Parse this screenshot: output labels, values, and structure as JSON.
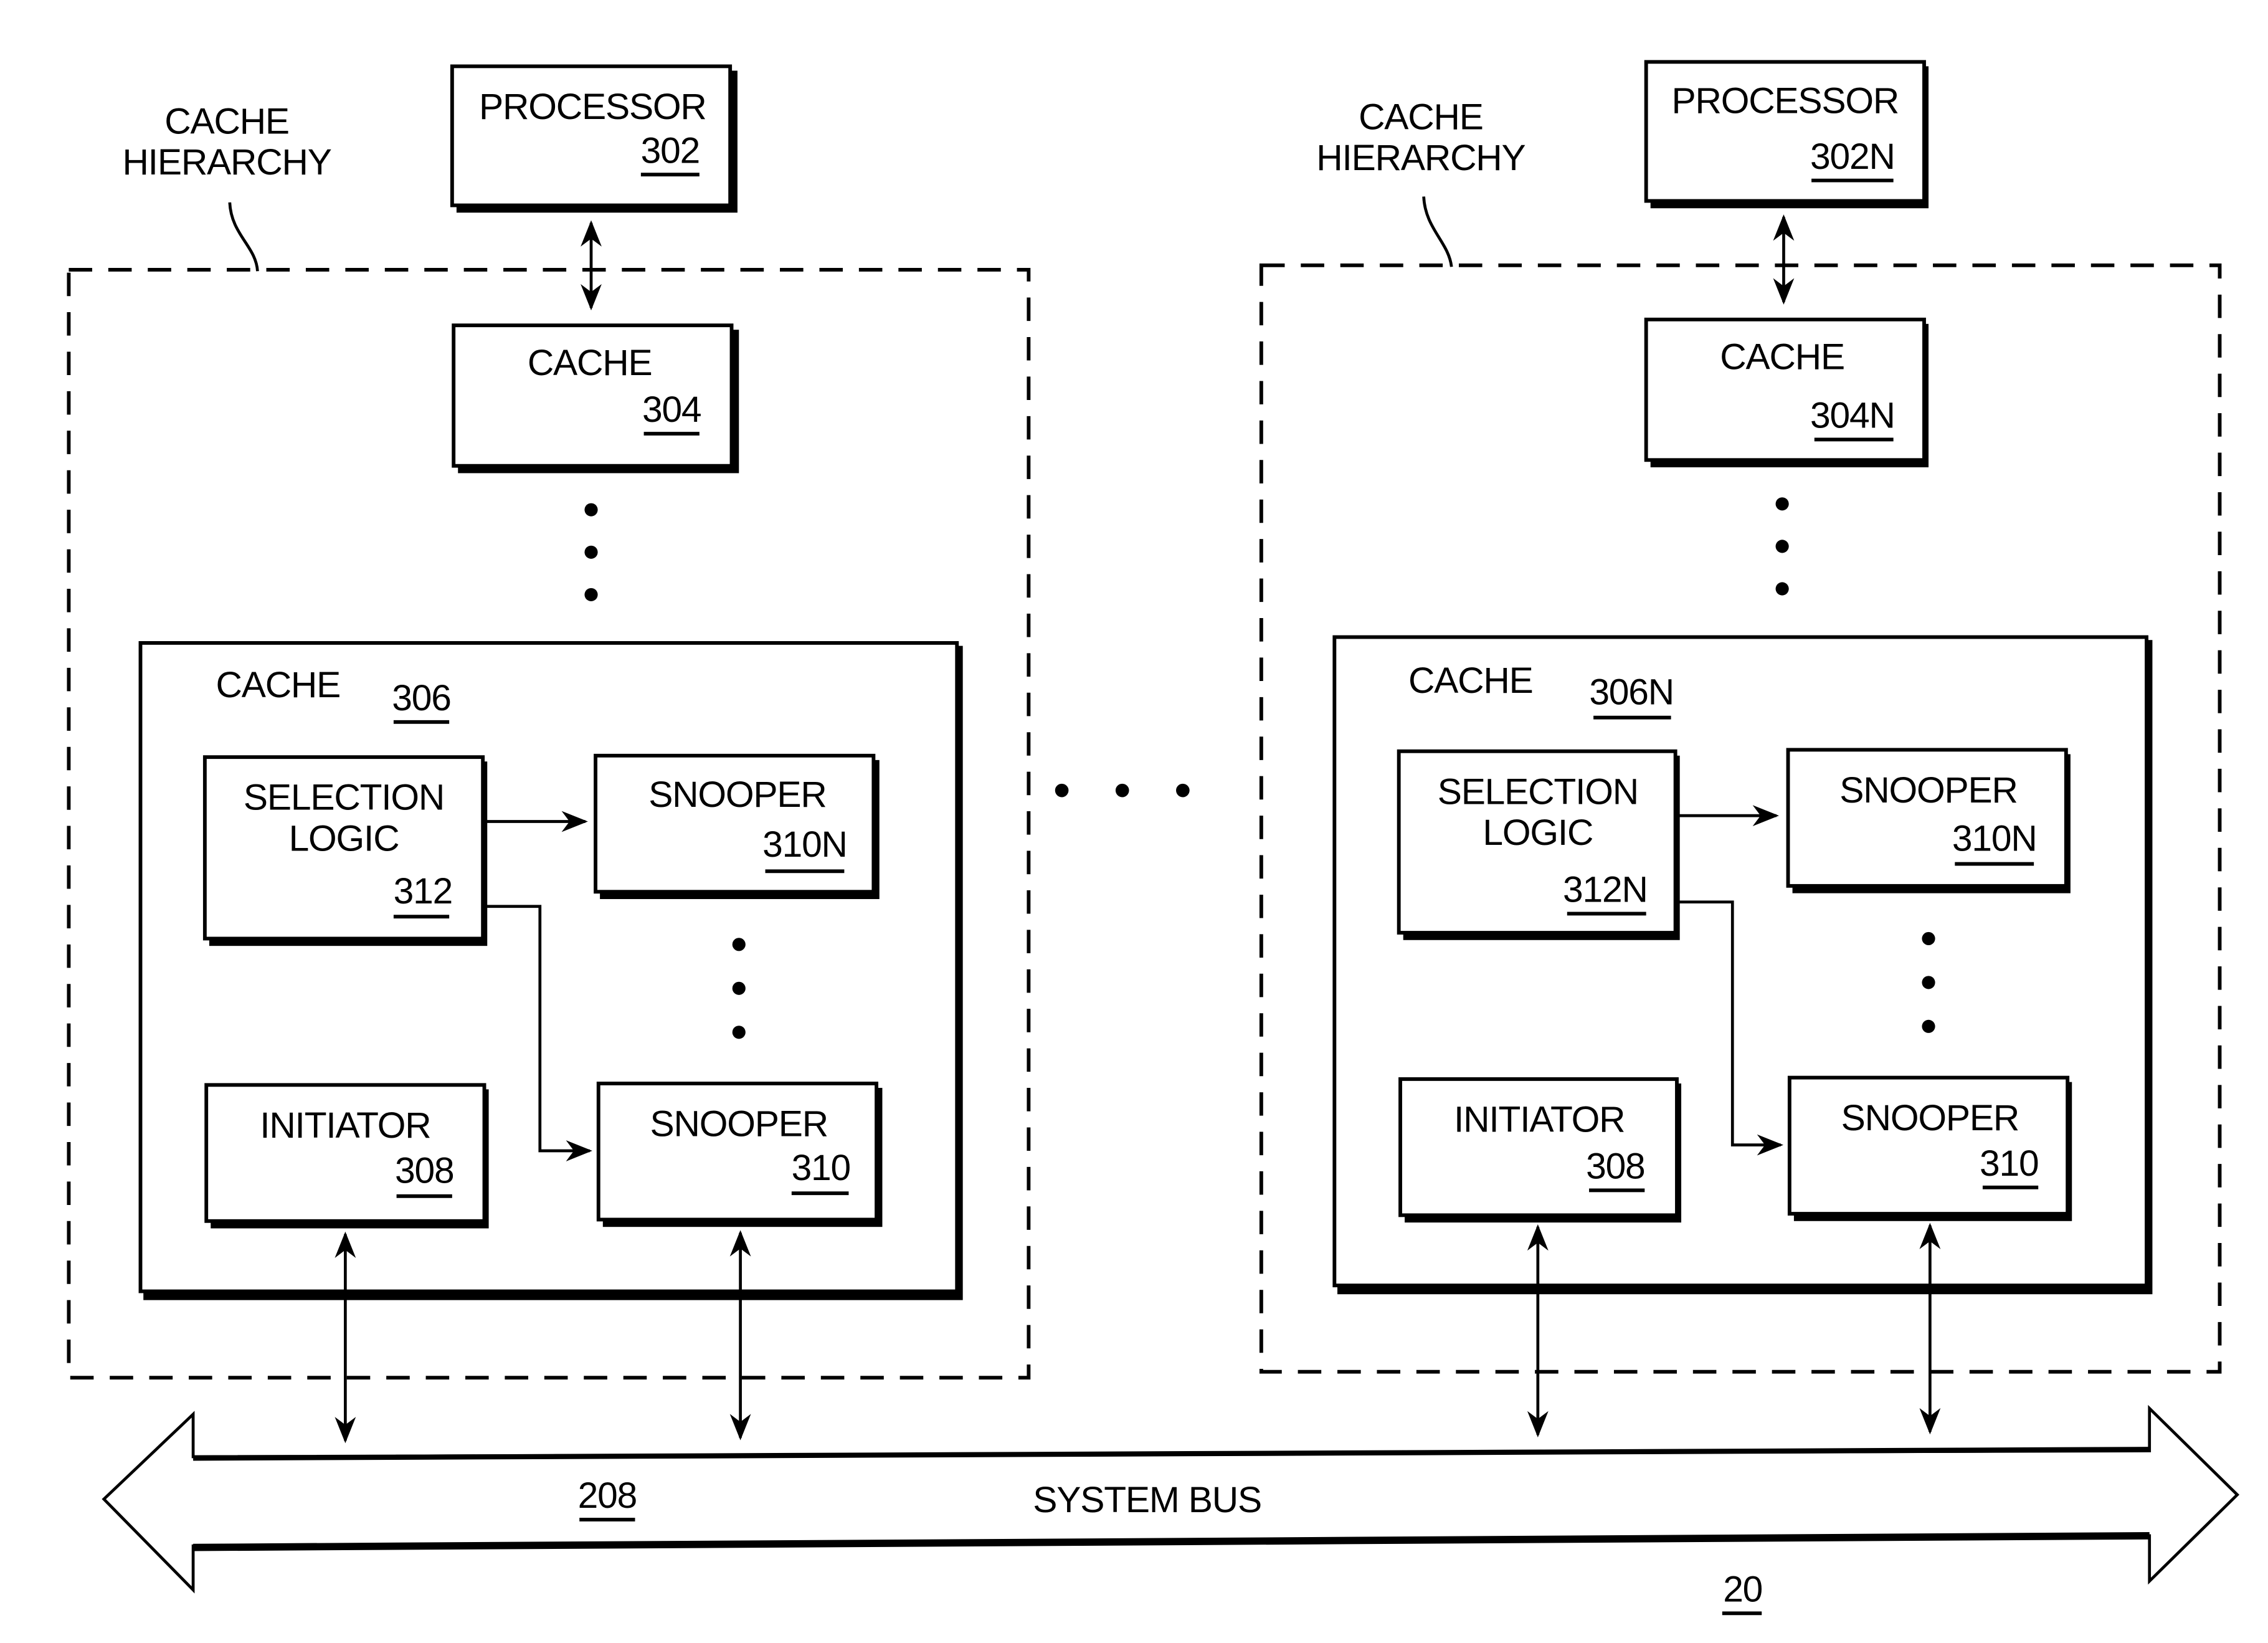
{
  "diagram": {
    "ellipsis": "• • •",
    "left": {
      "hierarchy_label": [
        "CACHE",
        "HIERARCHY"
      ],
      "processor": {
        "label": "PROCESSOR",
        "ref": "302"
      },
      "cache_top": {
        "label": "CACHE",
        "ref": "304"
      },
      "cache_main": {
        "label": "CACHE",
        "ref": "306"
      },
      "selection_logic": {
        "label": [
          "SELECTION",
          "LOGIC"
        ],
        "ref": "312"
      },
      "snooper_n": {
        "label": "SNOOPER",
        "ref": "310N"
      },
      "snooper": {
        "label": "SNOOPER",
        "ref": "310"
      },
      "initiator": {
        "label": "INITIATOR",
        "ref": "308"
      }
    },
    "right": {
      "hierarchy_label": [
        "CACHE",
        "HIERARCHY"
      ],
      "processor": {
        "label": "PROCESSOR",
        "ref": "302N"
      },
      "cache_top": {
        "label": "CACHE",
        "ref": "304N"
      },
      "cache_main": {
        "label": "CACHE",
        "ref": "306N"
      },
      "selection_logic": {
        "label": [
          "SELECTION",
          "LOGIC"
        ],
        "ref": "312N"
      },
      "snooper_n": {
        "label": "SNOOPER",
        "ref": "310N"
      },
      "snooper": {
        "label": "SNOOPER",
        "ref": "310"
      },
      "initiator": {
        "label": "INITIATOR",
        "ref": "308"
      }
    },
    "bus": {
      "label": "SYSTEM BUS",
      "ref": "208",
      "figure_ref": "20"
    }
  }
}
